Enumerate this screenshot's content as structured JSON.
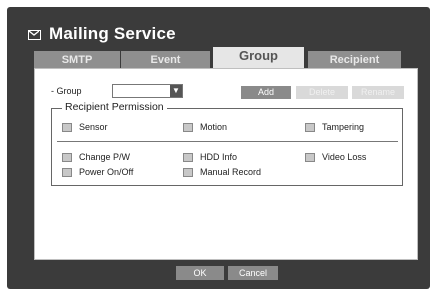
{
  "window": {
    "title": "Mailing Service",
    "title_icon": "envelope-icon"
  },
  "tabs": [
    {
      "label": "SMTP",
      "active": false
    },
    {
      "label": "Event",
      "active": false
    },
    {
      "label": "Group",
      "active": true
    },
    {
      "label": "Recipient",
      "active": false
    }
  ],
  "group": {
    "label": "- Group",
    "selected_value": "",
    "add_label": "Add",
    "delete_label": "Delete",
    "rename_label": "Rename"
  },
  "permission": {
    "legend": "Recipient Permission",
    "items": [
      {
        "label": "Sensor",
        "checked": false
      },
      {
        "label": "Motion",
        "checked": false
      },
      {
        "label": "Tampering",
        "checked": false
      },
      {
        "label": "Change P/W",
        "checked": false
      },
      {
        "label": "HDD Info",
        "checked": false
      },
      {
        "label": "Video Loss",
        "checked": false
      },
      {
        "label": "Power On/Off",
        "checked": false
      },
      {
        "label": "Manual Record",
        "checked": false
      }
    ]
  },
  "footer": {
    "ok_label": "OK",
    "cancel_label": "Cancel"
  },
  "colors": {
    "frame": "#3b3b3b",
    "tab_inactive": "#8f8f8f",
    "tab_active": "#e6e6e6",
    "button": "#8a8a8a",
    "button_disabled": "#d9d9d9"
  }
}
